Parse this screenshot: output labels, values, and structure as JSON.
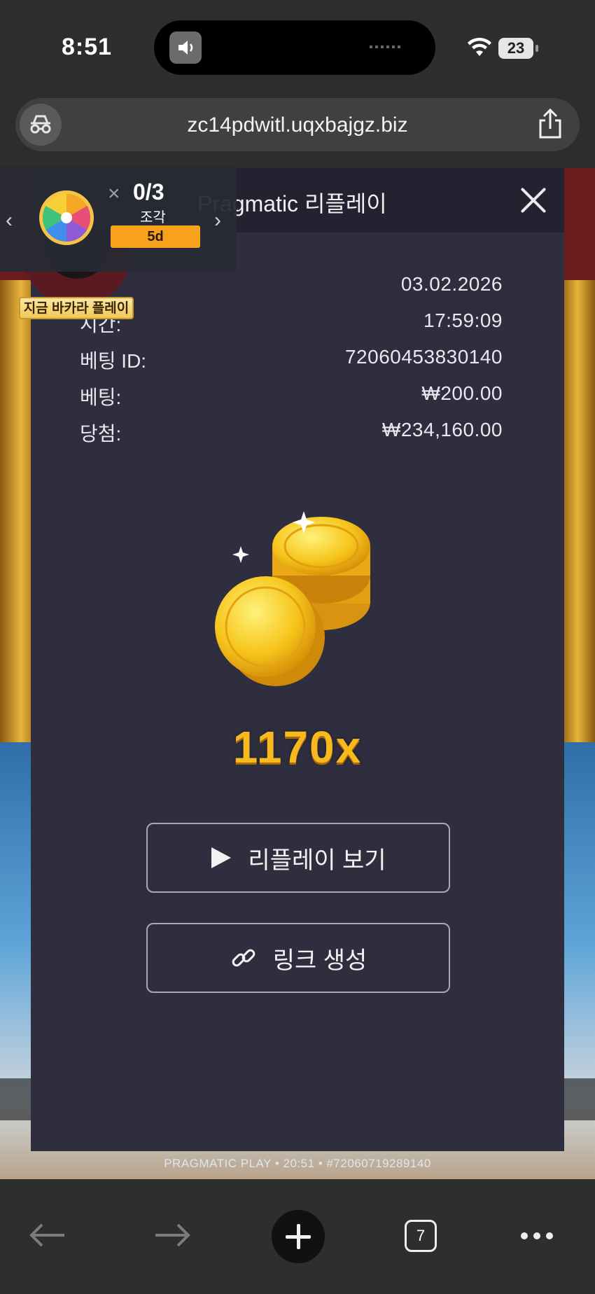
{
  "status_bar": {
    "time": "8:51",
    "battery": "23"
  },
  "browser": {
    "url": "zc14pdwitl.uqxbajgz.biz",
    "tab_count": "7"
  },
  "game": {
    "footer": "PRAGMATIC PLAY • 20:51 • #72060719289140"
  },
  "event_widget": {
    "progress": "0/3",
    "unit": "조각",
    "days_left": "5d",
    "play_tag": "지금 바카라 플레이"
  },
  "modal": {
    "title": "Pragmatic 리플레이",
    "details": [
      {
        "label": "",
        "value": "03.02.2026"
      },
      {
        "label": "시간:",
        "value": "17:59:09"
      },
      {
        "label": "베팅 ID:",
        "value": "72060453830140"
      },
      {
        "label": "베팅:",
        "value": "₩200.00"
      },
      {
        "label": "당첨:",
        "value": "₩234,160.00"
      }
    ],
    "multiplier": "1170x",
    "replay_button": "리플레이 보기",
    "link_button": "링크 생성"
  }
}
